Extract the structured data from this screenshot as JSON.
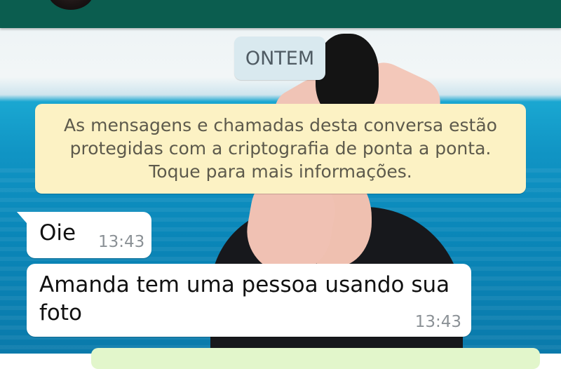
{
  "header": {
    "avatar_icon": "contact-avatar"
  },
  "chat": {
    "date_chip": "ONTEM",
    "security_note": {
      "lines": [
        "As mensagens e chamadas desta conversa estão",
        "protegidas com a criptografia de ponta a ponta.",
        "Toque para mais informações."
      ]
    },
    "messages": [
      {
        "text": "Oie",
        "time": "13:43"
      },
      {
        "text": "Amanda tem uma pessoa usando sua foto",
        "time": "13:43"
      }
    ]
  },
  "colors": {
    "header_bg": "#0b5d4f",
    "incoming_bubble": "#ffffff",
    "security_note_bg": "#fcf2c4",
    "date_chip_bg": "#d9e9ef",
    "outgoing_bubble": "#e2f6cb"
  }
}
